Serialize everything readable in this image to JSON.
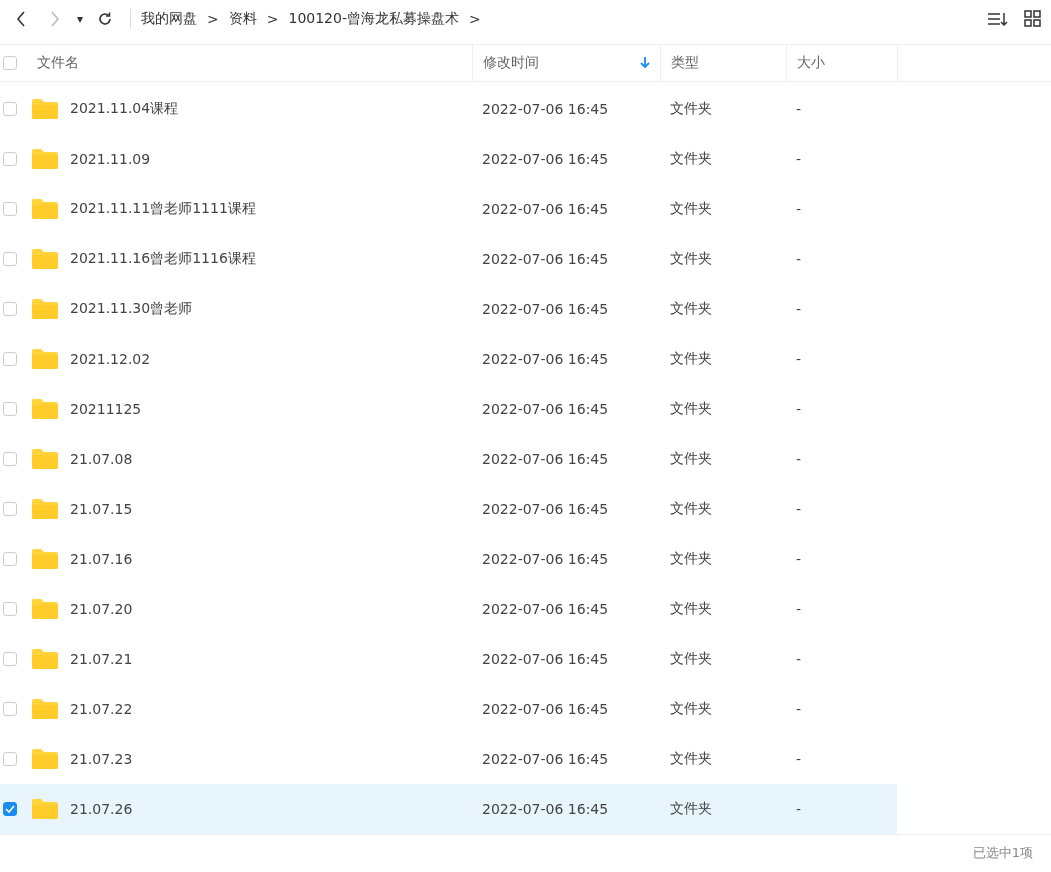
{
  "toolbar": {
    "dropdown": "▾",
    "breadcrumb": [
      {
        "label": "我的网盘"
      },
      {
        "label": "资料"
      },
      {
        "label": "100120-曾海龙私募操盘术"
      }
    ],
    "separator": ">"
  },
  "table": {
    "all_checked": false,
    "columns": [
      {
        "label": "文件名",
        "sorted": false
      },
      {
        "label": "修改时间",
        "sorted": true
      },
      {
        "label": "类型",
        "sorted": false
      },
      {
        "label": "大小",
        "sorted": false
      }
    ],
    "rows": [
      {
        "name": "2021.11.04课程",
        "modified": "2022-07-06 16:45",
        "type": "文件夹",
        "size": "-",
        "selected": false
      },
      {
        "name": "2021.11.09",
        "modified": "2022-07-06 16:45",
        "type": "文件夹",
        "size": "-",
        "selected": false
      },
      {
        "name": "2021.11.11曾老师1111课程",
        "modified": "2022-07-06 16:45",
        "type": "文件夹",
        "size": "-",
        "selected": false
      },
      {
        "name": "2021.11.16曾老师1116课程",
        "modified": "2022-07-06 16:45",
        "type": "文件夹",
        "size": "-",
        "selected": false
      },
      {
        "name": "2021.11.30曾老师",
        "modified": "2022-07-06 16:45",
        "type": "文件夹",
        "size": "-",
        "selected": false
      },
      {
        "name": "2021.12.02",
        "modified": "2022-07-06 16:45",
        "type": "文件夹",
        "size": "-",
        "selected": false
      },
      {
        "name": "20211125",
        "modified": "2022-07-06 16:45",
        "type": "文件夹",
        "size": "-",
        "selected": false
      },
      {
        "name": "21.07.08",
        "modified": "2022-07-06 16:45",
        "type": "文件夹",
        "size": "-",
        "selected": false
      },
      {
        "name": "21.07.15",
        "modified": "2022-07-06 16:45",
        "type": "文件夹",
        "size": "-",
        "selected": false
      },
      {
        "name": "21.07.16",
        "modified": "2022-07-06 16:45",
        "type": "文件夹",
        "size": "-",
        "selected": false
      },
      {
        "name": "21.07.20",
        "modified": "2022-07-06 16:45",
        "type": "文件夹",
        "size": "-",
        "selected": false
      },
      {
        "name": "21.07.21",
        "modified": "2022-07-06 16:45",
        "type": "文件夹",
        "size": "-",
        "selected": false
      },
      {
        "name": "21.07.22",
        "modified": "2022-07-06 16:45",
        "type": "文件夹",
        "size": "-",
        "selected": false
      },
      {
        "name": "21.07.23",
        "modified": "2022-07-06 16:45",
        "type": "文件夹",
        "size": "-",
        "selected": false
      },
      {
        "name": "21.07.26",
        "modified": "2022-07-06 16:45",
        "type": "文件夹",
        "size": "-",
        "selected": true
      }
    ]
  },
  "status_bar": {
    "text": "已选中1项"
  }
}
